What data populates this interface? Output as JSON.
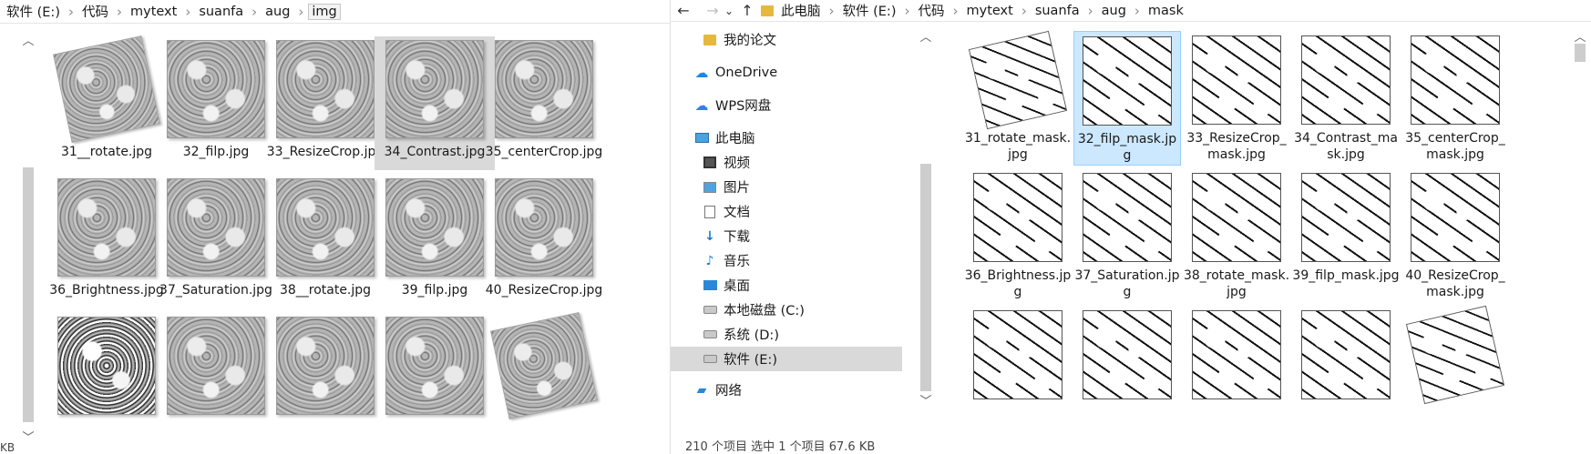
{
  "left": {
    "breadcrumb": [
      "软件 (E:)",
      "代码",
      "mytext",
      "suanfa",
      "aug",
      "img"
    ],
    "files": [
      {
        "label": "31__rotate.jpg",
        "style": "rot"
      },
      {
        "label": "32_filp.jpg",
        "style": ""
      },
      {
        "label": "33_ResizeCrop.jpg",
        "style": ""
      },
      {
        "label": "34_Contrast.jpg",
        "style": "hovered"
      },
      {
        "label": "35_centerCrop.jpg",
        "style": ""
      },
      {
        "label": "36_Brightness.jpg",
        "style": ""
      },
      {
        "label": "37_Saturation.jpg",
        "style": ""
      },
      {
        "label": "38__rotate.jpg",
        "style": ""
      },
      {
        "label": "39_filp.jpg",
        "style": ""
      },
      {
        "label": "40_ResizeCrop.jpg",
        "style": ""
      },
      {
        "label": "",
        "style": "dark"
      },
      {
        "label": "",
        "style": ""
      },
      {
        "label": "",
        "style": ""
      },
      {
        "label": "",
        "style": ""
      },
      {
        "label": "",
        "style": "rot"
      }
    ],
    "status": "KB"
  },
  "right": {
    "toolbar": {
      "back": "←",
      "forward": "→",
      "recent": "⌄",
      "up": "↑"
    },
    "breadcrumb": [
      "此电脑",
      "软件 (E:)",
      "代码",
      "mytext",
      "suanfa",
      "aug",
      "mask"
    ],
    "nav": [
      {
        "label": "我的论文",
        "icon": "folder-icon",
        "indent": 1
      },
      {
        "label": "OneDrive",
        "icon": "cloud-icon",
        "indent": 0
      },
      {
        "label": "WPS网盘",
        "icon": "wps-cloud-icon",
        "indent": 0
      },
      {
        "label": "此电脑",
        "icon": "computer-icon",
        "indent": 0
      },
      {
        "label": "视频",
        "icon": "video-icon",
        "indent": 1
      },
      {
        "label": "图片",
        "icon": "picture-icon",
        "indent": 1
      },
      {
        "label": "文档",
        "icon": "document-icon",
        "indent": 1
      },
      {
        "label": "下载",
        "icon": "download-icon",
        "indent": 1
      },
      {
        "label": "音乐",
        "icon": "music-icon",
        "indent": 1
      },
      {
        "label": "桌面",
        "icon": "desktop-icon",
        "indent": 1
      },
      {
        "label": "本地磁盘 (C:)",
        "icon": "drive-icon",
        "indent": 1
      },
      {
        "label": "系统 (D:)",
        "icon": "drive-icon",
        "indent": 1
      },
      {
        "label": "软件 (E:)",
        "icon": "drive-icon",
        "indent": 1,
        "selected": true
      },
      {
        "label": "网络",
        "icon": "network-icon",
        "indent": 0
      }
    ],
    "files": [
      {
        "label": "31_rotate_mask.jpg",
        "style": "rot"
      },
      {
        "label": "32_filp_mask.jpg",
        "style": "selected"
      },
      {
        "label": "33_ResizeCrop_mask.jpg",
        "style": ""
      },
      {
        "label": "34_Contrast_mask.jpg",
        "style": ""
      },
      {
        "label": "35_centerCrop_mask.jpg",
        "style": ""
      },
      {
        "label": "36_Brightness.jpg",
        "style": ""
      },
      {
        "label": "37_Saturation.jpg",
        "style": ""
      },
      {
        "label": "38_rotate_mask.jpg",
        "style": ""
      },
      {
        "label": "39_filp_mask.jpg",
        "style": ""
      },
      {
        "label": "40_ResizeCrop_mask.jpg",
        "style": ""
      },
      {
        "label": "",
        "style": ""
      },
      {
        "label": "",
        "style": ""
      },
      {
        "label": "",
        "style": ""
      },
      {
        "label": "",
        "style": ""
      },
      {
        "label": "",
        "style": "rot"
      }
    ],
    "status": "210 个项目    选中 1 个项目  67.6 KB"
  }
}
